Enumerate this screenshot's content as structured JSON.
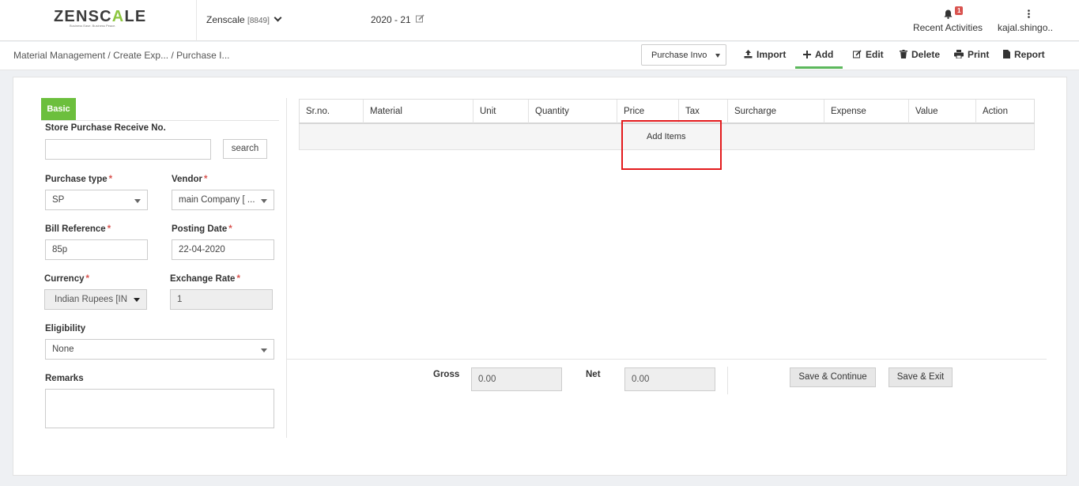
{
  "header": {
    "logo_left": "ZENSC",
    "logo_accent": "A",
    "logo_right": "LE",
    "logo_tagline": "Business Ease. Business Peace.",
    "company_name": "Zenscale",
    "company_code": "[8849]",
    "fiscal_year": "2020 - 21",
    "notification_count": "1",
    "recent_activities": "Recent Activities",
    "user_name": "kajal.shingo.."
  },
  "breadcrumb": {
    "items": [
      "Material Management",
      " / Create Exp...",
      " / Purchase I..."
    ]
  },
  "toolbar": {
    "doc_type_select": "Purchase Invoice",
    "import": "Import",
    "add": "Add",
    "edit": "Edit",
    "delete": "Delete",
    "print": "Print",
    "report": "Report"
  },
  "form": {
    "tab_basic": "Basic",
    "store_receive_label": "Store Purchase Receive No.",
    "store_receive_value": "",
    "search_button": "search",
    "purchase_type_label": "Purchase type",
    "purchase_type_value": "SP",
    "vendor_label": "Vendor",
    "vendor_value": "main Company [ ...",
    "bill_reference_label": "Bill Reference",
    "bill_reference_value": "85p",
    "posting_date_label": "Posting Date",
    "posting_date_value": "22-04-2020",
    "currency_label": "Currency",
    "currency_value": "Indian Rupees [IN",
    "exchange_rate_label": "Exchange Rate",
    "exchange_rate_value": "1",
    "eligibility_label": "Eligibility",
    "eligibility_value": "None",
    "remarks_label": "Remarks",
    "required_mark": "*"
  },
  "items_table": {
    "columns": [
      "Sr.no.",
      "Material",
      "Unit",
      "Quantity",
      "Price",
      "Tax",
      "Surcharge",
      "Expense",
      "Value",
      "Action"
    ],
    "add_items": "Add Items"
  },
  "footer": {
    "gross_label": "Gross",
    "gross_value": "0.00",
    "net_label": "Net",
    "net_value": "0.00",
    "save_continue": "Save & Continue",
    "save_exit": "Save & Exit"
  },
  "colors": {
    "brand_green": "#6cbf3d",
    "highlight_red": "#e31a1c",
    "badge_red": "#d9534f"
  }
}
